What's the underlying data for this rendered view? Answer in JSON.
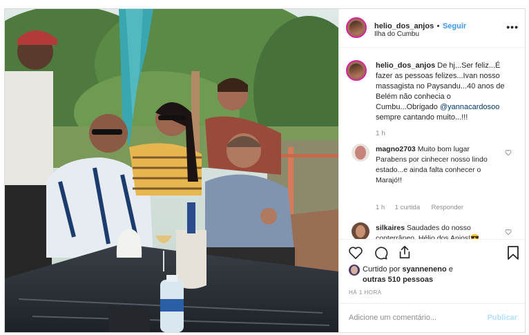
{
  "post": {
    "username": "helio_dos_anjos",
    "dot": "•",
    "follow_label": "Seguir",
    "location": "Ilha do Cumbu",
    "more_icon": "more-horizontal-icon"
  },
  "caption": {
    "username": "helio_dos_anjos",
    "text_before": " De hj...Ser feliz...É fazer as pessoas felizes...Ivan nosso massagista no Paysandu...40 anos de Belém não conhecia o Cumbu...Obrigado ",
    "mention": "@yannacardosoo",
    "text_after": " sempre cantando muito...!!!",
    "time": "1 h"
  },
  "comments": [
    {
      "username": "magno2703",
      "text": " Muito bom lugar Parabens por cinhecer nosso lindo estado...e ainda falta conhecer o Marajó!!",
      "time": "1 h",
      "likes": "1 curtida",
      "reply": "Responder"
    },
    {
      "username": "silkaires",
      "text": " Saudades do nosso conterrâneo, Hélio dos Anjos!😎"
    }
  ],
  "actions": {
    "liked_prefix": "Curtido por ",
    "liked_user": "syanneneno",
    "liked_middle": " e",
    "liked_others": "outras 510 pessoas",
    "ago": "HÁ 1 HORA"
  },
  "add_comment": {
    "placeholder": "Adicione um comentário...",
    "publish": "Publicar"
  },
  "colors": {
    "follow": "#3897f0",
    "story_ring": "#d6249f",
    "publish_disabled": "#b2dffc",
    "muted": "#8e8e8e"
  }
}
